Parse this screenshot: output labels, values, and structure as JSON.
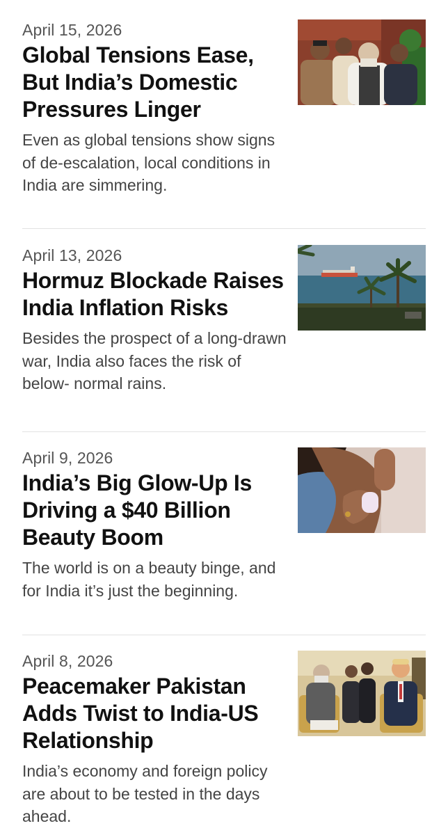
{
  "articles": [
    {
      "date": "April 15, 2026",
      "headline": "Global Tensions Ease, But India’s Domestic Pressures Linger",
      "summary": "Even as global tensions show signs of de-escalation, local conditions in India are simmering.",
      "image_icon": "group-of-politicians-photo-icon"
    },
    {
      "date": "April 13, 2026",
      "headline": "Hormuz Blockade Raises India Inflation Risks",
      "summary": "Besides the prospect of a long-drawn war, India also faces the risk of below- normal rains.",
      "image_icon": "tanker-ship-palm-trees-photo-icon"
    },
    {
      "date": "April 9, 2026",
      "headline": "India’s Big Glow-Up Is Driving a $40 Billion Beauty Boom",
      "summary": "The world is on a beauty binge, and for India it’s just the beginning.",
      "image_icon": "woman-applying-cosmetics-photo-icon"
    },
    {
      "date": "April 8, 2026",
      "headline": "Peacemaker Pakistan Adds Twist to India-US Relationship",
      "summary": "India’s economy and foreign policy are about to be tested in the days ahead.",
      "image_icon": "leaders-meeting-photo-icon"
    }
  ],
  "colors": {
    "headline": "#111111",
    "date": "#555555",
    "summary": "#444444",
    "divider": "#e2e2e2"
  }
}
